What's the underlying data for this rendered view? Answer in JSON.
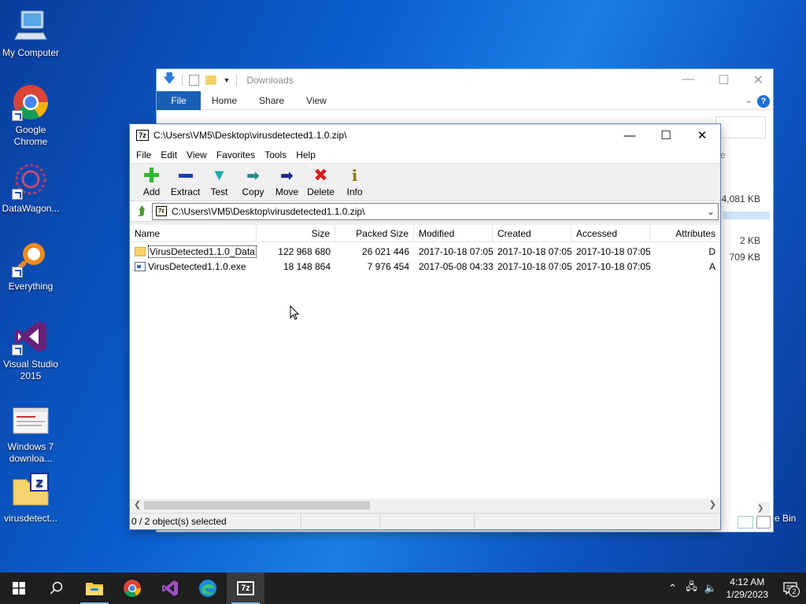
{
  "desktop": {
    "icons": [
      {
        "label": "My Computer"
      },
      {
        "label": "Google Chrome"
      },
      {
        "label": "DataWagon..."
      },
      {
        "label": "Everything"
      },
      {
        "label": "Visual Studio 2015"
      },
      {
        "label": "Windows 7 downloa..."
      },
      {
        "label": "virusdetect..."
      }
    ]
  },
  "explorer": {
    "title": "Downloads",
    "ribbon": {
      "file": "File",
      "home": "Home",
      "share": "Share",
      "view": "View"
    },
    "help": "?",
    "sizes": [
      "4,081 KB",
      "2 KB",
      "709 KB"
    ],
    "partial_text": "e",
    "recycle_bin": "e Bin"
  },
  "zip": {
    "title": "C:\\Users\\VM5\\Desktop\\virusdetected1.1.0.zip\\",
    "app_icon": "7z",
    "menu": [
      "File",
      "Edit",
      "View",
      "Favorites",
      "Tools",
      "Help"
    ],
    "toolbar": {
      "add": "Add",
      "extract": "Extract",
      "test": "Test",
      "copy": "Copy",
      "move": "Move",
      "delete": "Delete",
      "info": "Info"
    },
    "address": "C:\\Users\\VM5\\Desktop\\virusdetected1.1.0.zip\\",
    "columns": {
      "name": "Name",
      "size": "Size",
      "packed": "Packed Size",
      "modified": "Modified",
      "created": "Created",
      "accessed": "Accessed",
      "attributes": "Attributes"
    },
    "rows": [
      {
        "name": "VirusDetected1.1.0_Data",
        "size": "122 968 680",
        "packed": "26 021 446",
        "modified": "2017-10-18 07:05",
        "created": "2017-10-18 07:05",
        "accessed": "2017-10-18 07:05",
        "attr": "D"
      },
      {
        "name": "VirusDetected1.1.0.exe",
        "size": "18 148 864",
        "packed": "7 976 454",
        "modified": "2017-05-08 04:33",
        "created": "2017-10-18 07:05",
        "accessed": "2017-10-18 07:05",
        "attr": "A"
      }
    ],
    "status": "0 / 2 object(s) selected"
  },
  "taskbar": {
    "time": "4:12 AM",
    "date": "1/29/2023",
    "notifications": "2"
  }
}
